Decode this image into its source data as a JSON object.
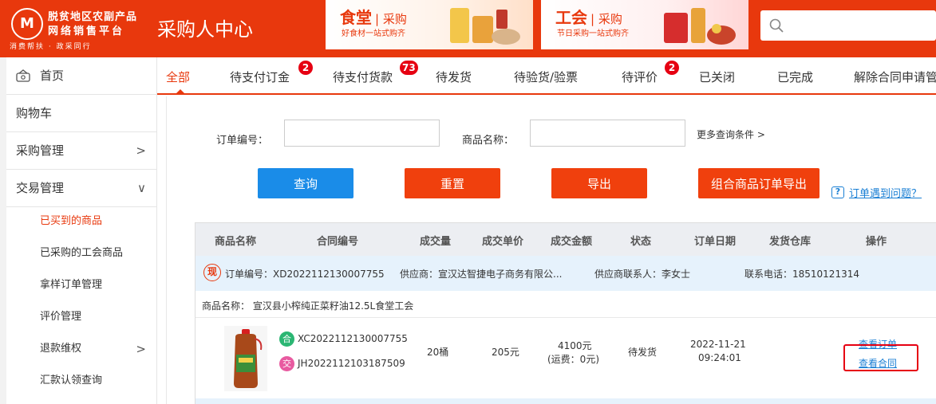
{
  "header": {
    "logo_emblem": "M",
    "logo_line1": "脱贫地区农副产品",
    "logo_line2": "网络销售平台",
    "logo_slogan": "消费帮扶 · 政采同行",
    "center_title": "采购人中心",
    "banners": [
      {
        "title": "食堂",
        "sub": "| 采购",
        "desc": "好食材一站式购齐"
      },
      {
        "title": "工会",
        "sub": "| 采购",
        "desc": "节日采购一站式购齐"
      }
    ],
    "search_placeholder": ""
  },
  "sidebar": {
    "items": [
      {
        "label": "首页",
        "icon": "home-icon"
      },
      {
        "label": "购物车"
      },
      {
        "label": "采购管理",
        "chevron": ">"
      },
      {
        "label": "交易管理",
        "chevron": "∨"
      }
    ],
    "subitems": [
      {
        "label": "已买到的商品",
        "active": true
      },
      {
        "label": "已采购的工会商品"
      },
      {
        "label": "拿样订单管理"
      },
      {
        "label": "评价管理"
      },
      {
        "label": "退款维权",
        "chevron": ">"
      },
      {
        "label": "汇款认领查询"
      }
    ]
  },
  "tabs": [
    {
      "label": "全部",
      "active": true
    },
    {
      "label": "待支付订金",
      "badge": "2"
    },
    {
      "label": "待支付货款",
      "badge": "73"
    },
    {
      "label": "待发货"
    },
    {
      "label": "待验货/验票"
    },
    {
      "label": "待评价",
      "badge": "2"
    },
    {
      "label": "已关闭"
    },
    {
      "label": "已完成"
    },
    {
      "label": "解除合同申请管"
    }
  ],
  "filters": {
    "order_no_label": "订单编号：",
    "order_no_value": "",
    "product_name_label": "商品名称：",
    "product_name_value": "",
    "more_label": "更多查询条件 >"
  },
  "buttons": {
    "query": "查询",
    "reset": "重置",
    "export": "导出",
    "combo_export": "组合商品订单导出"
  },
  "help": {
    "icon": "?",
    "text": "订单遇到问题？"
  },
  "table": {
    "headers": [
      "商品名称",
      "合同编号",
      "成交量",
      "成交单价",
      "成交金额",
      "状态",
      "订单日期",
      "发货仓库",
      "操作"
    ],
    "order": {
      "type_icon": "现",
      "order_no": "订单编号：XD2022112130007755",
      "supplier": "供应商：宣汉达智捷电子商务有限公...",
      "contact": "供应商联系人：李女士",
      "phone": "联系电话：18510121314"
    },
    "product_line": "商品名称：  宣汉县小榨纯正菜籽油12.5L食堂工会",
    "item": {
      "contract_tag_he": "合",
      "contract_no_1": "XC2022112130007755",
      "contract_tag_jiao": "交",
      "contract_no_2": "JH2022112103187509",
      "quantity": "20桶",
      "unit_price": "205元",
      "amount": "4100元",
      "freight": "(运费：0元)",
      "status": "待发货",
      "date": "2022-11-21",
      "time": "09:24:01",
      "warehouse": "",
      "op_view_order": "查看订单",
      "op_view_contract": "查看合同"
    }
  }
}
